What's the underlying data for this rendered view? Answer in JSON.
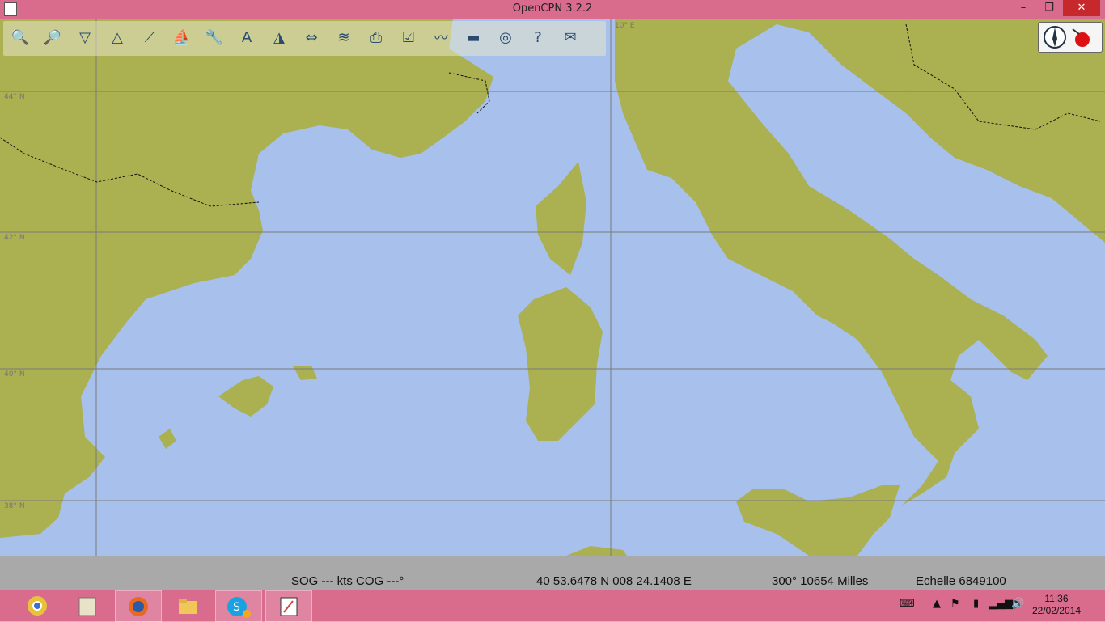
{
  "window": {
    "title": "OpenCPN 3.2.2",
    "minimize": "–",
    "maximize": "❐",
    "close": "✕"
  },
  "toolbar": {
    "tools": [
      {
        "name": "zoom-in",
        "glyph": "🔍"
      },
      {
        "name": "zoom-out",
        "glyph": "🔎"
      },
      {
        "name": "scale-up",
        "glyph": "▽"
      },
      {
        "name": "scale-down",
        "glyph": "△"
      },
      {
        "name": "route",
        "glyph": "⟋"
      },
      {
        "name": "follow-ship",
        "glyph": "⛵"
      },
      {
        "name": "settings",
        "glyph": "🔧"
      },
      {
        "name": "text",
        "glyph": "A"
      },
      {
        "name": "currents",
        "glyph": "◮"
      },
      {
        "name": "tides",
        "glyph": "⇔"
      },
      {
        "name": "tide-station",
        "glyph": "≋"
      },
      {
        "name": "print",
        "glyph": "⎙"
      },
      {
        "name": "route-manager",
        "glyph": "☑"
      },
      {
        "name": "track",
        "glyph": "〰"
      },
      {
        "name": "color-scheme",
        "glyph": "▬"
      },
      {
        "name": "man-overboard",
        "glyph": "◎"
      },
      {
        "name": "help",
        "glyph": "?"
      },
      {
        "name": "about",
        "glyph": "✉"
      }
    ]
  },
  "map": {
    "colors": {
      "sea": "#a7c0ec",
      "land": "#abb050",
      "grid": "#7a7a7a"
    },
    "latitude_labels": [
      "44° N",
      "42° N",
      "40° N",
      "38° N"
    ],
    "longitude_labels": [
      "10° E"
    ]
  },
  "status": {
    "sog_cog": "SOG --- kts  COG ---°",
    "position": "40 53.6478 N   008 24.1408 E",
    "bearing_distance": "300°  10654 Milles",
    "scale": "Echelle 6849100"
  },
  "taskbar": {
    "apps": [
      "chrome",
      "papers",
      "firefox",
      "explorer",
      "skype",
      "opencpn"
    ],
    "skype_badge": "1",
    "clock_time": "11:36",
    "clock_date": "22/02/2014"
  }
}
